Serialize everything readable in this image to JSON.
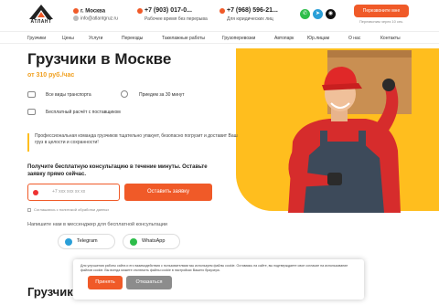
{
  "header": {
    "logo_text": "АТЛАНТ",
    "city": "г. Москва",
    "email": "info@atlantgruz.ru",
    "phone1": "+7 (903) 017-0...",
    "phone1_note": "Рабочее время без перерыва",
    "phone2": "+7 (968) 596-21...",
    "phone2_note": "Для юридических лиц",
    "callback": "Перезвоните мне",
    "callback_note": "Перезвоним через 10 сек."
  },
  "nav": [
    "Грузчики",
    "Цены",
    "Услуги",
    "Переезды",
    "Такелажные работы",
    "Грузоперевозки",
    "Автопарк",
    "Юр.лицам",
    "О нас",
    "Контакты"
  ],
  "hero": {
    "title": "Грузчики в Москве",
    "price": "от 310 руб./час",
    "features": [
      "Все виды транспорта",
      "Приедем за 30 минут",
      "Бесплатный расчёт с поставщиком"
    ],
    "description": "Профессиональная команда грузчиков тщательно упакует, безопасно погрузит и доставит Ваш груз в целости и сохранности!",
    "consult_title": "Получите бесплатную консультацию в течение минуты. Оставьте заявку прямо сейчас.",
    "phone_placeholder": "+7 ххх ххх хх хх",
    "submit": "Оставить заявку",
    "agree": "Соглашаюсь с политикой обработки данных",
    "messenger_text": "Напишите нам в мессенджер для бесплатной консультации",
    "telegram": "Telegram",
    "whatsapp": "WhatsApp"
  },
  "cookie": {
    "text": "Для улучшения работы сайта и его взаимодействия с пользователями мы используем файлы cookie. Оставаясь на сайте, вы подтверждаете свое согласие на использование файлов cookie. Вы всегда можете отключить файлы cookie в настройках Вашего браузера.",
    "accept": "Принять",
    "decline": "Отказаться"
  },
  "section_title": "Грузчики",
  "colors": {
    "accent": "#f05a28",
    "yellow": "#ffbe1e"
  }
}
